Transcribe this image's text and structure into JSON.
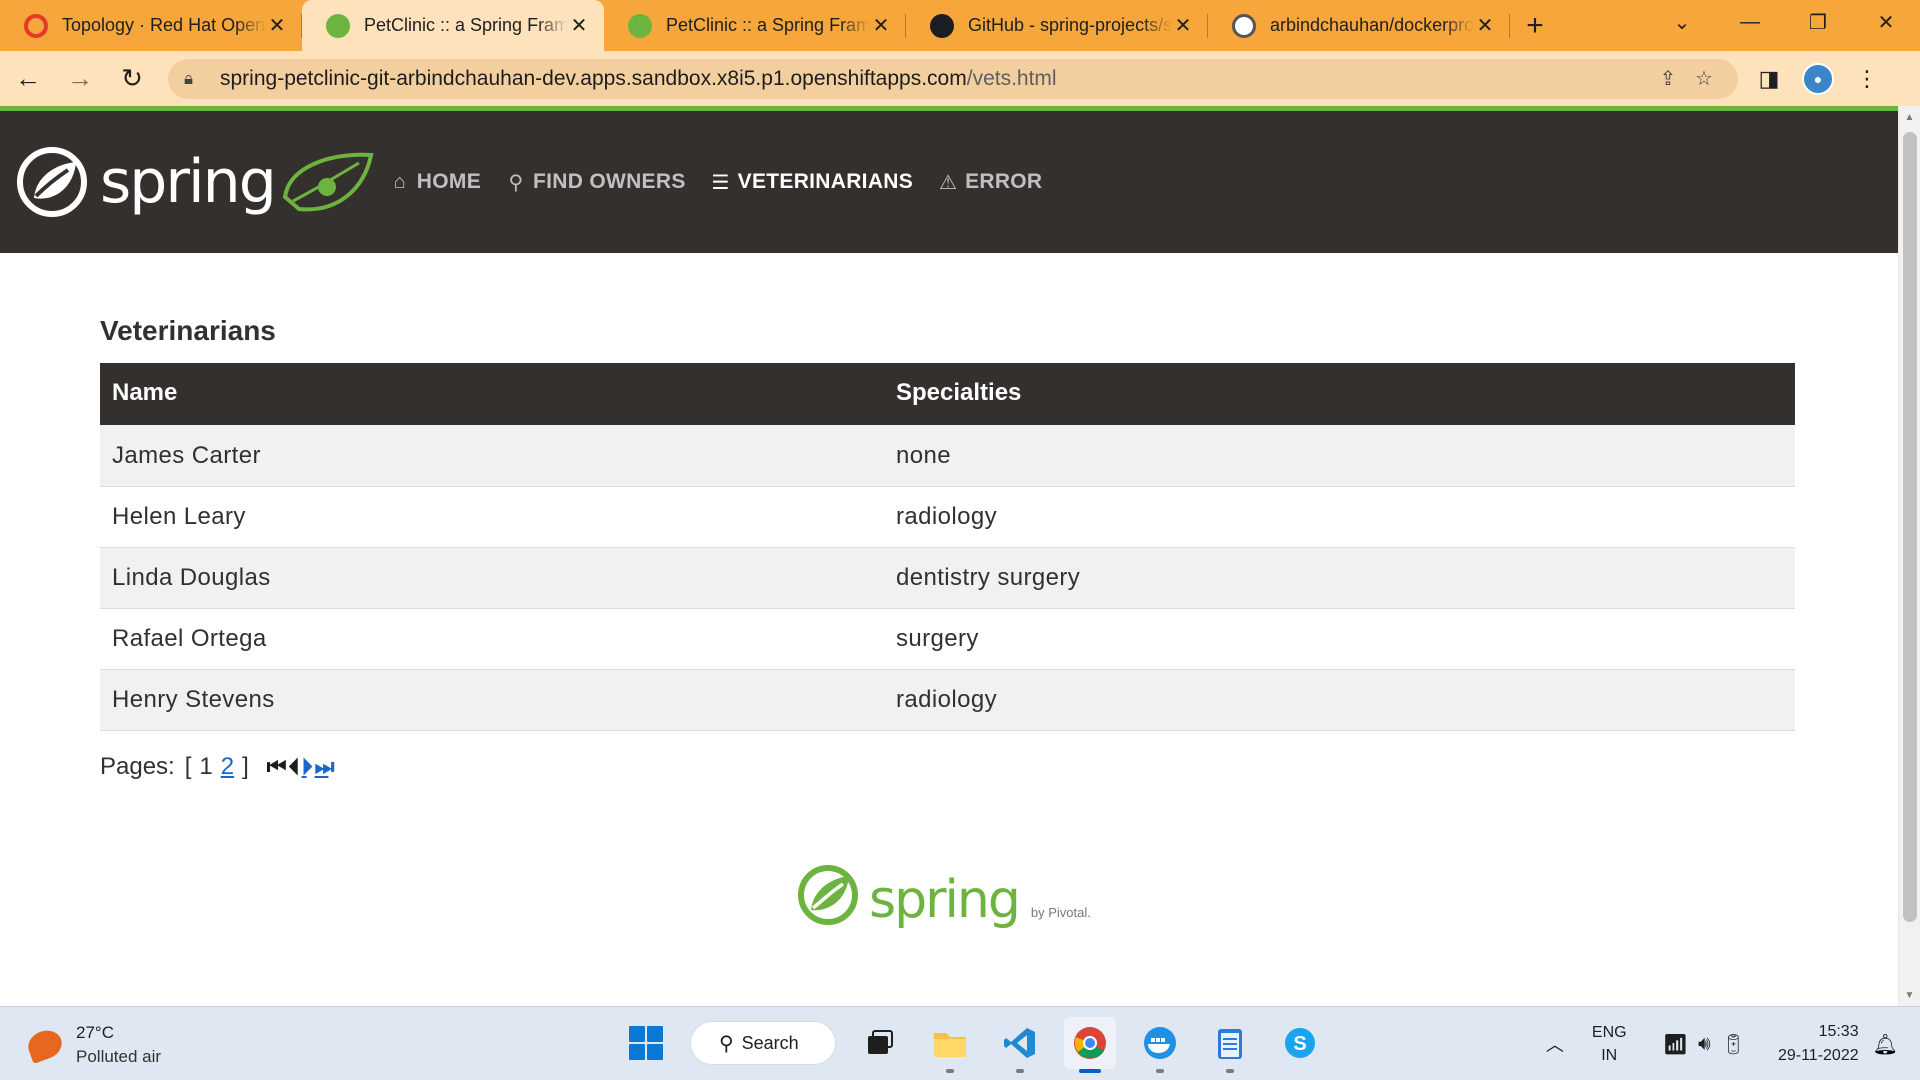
{
  "browser": {
    "tabs": [
      {
        "title": "Topology · Red Hat OpenShift",
        "favicon": "redhat-icon",
        "active": false
      },
      {
        "title": "PetClinic :: a Spring Framework demonstration",
        "favicon": "spring-icon",
        "active": true
      },
      {
        "title": "PetClinic :: a Spring Framework demonstration",
        "favicon": "spring-icon",
        "active": false
      },
      {
        "title": "GitHub - spring-projects/spring-petclinic",
        "favicon": "github-icon",
        "active": false
      },
      {
        "title": "arbindchauhan/dockerproject",
        "favicon": "docker-icon",
        "active": false
      }
    ],
    "url_host": "spring-petclinic-git-arbindchauhan-dev.apps.sandbox.x8i5.p1.openshiftapps.com",
    "url_path": "/vets.html"
  },
  "navbar": {
    "brand": "spring",
    "items": [
      {
        "label": "HOME",
        "icon": "home-icon",
        "active": false
      },
      {
        "label": "FIND OWNERS",
        "icon": "search-icon",
        "active": false
      },
      {
        "label": "VETERINARIANS",
        "icon": "list-icon",
        "active": true
      },
      {
        "label": "ERROR",
        "icon": "warning-icon",
        "active": false
      }
    ]
  },
  "page": {
    "title": "Veterinarians",
    "table": {
      "headers": [
        "Name",
        "Specialties"
      ],
      "rows": [
        {
          "name": "James Carter",
          "specialties": "none"
        },
        {
          "name": "Helen Leary",
          "specialties": "radiology"
        },
        {
          "name": "Linda Douglas",
          "specialties": "dentistry surgery"
        },
        {
          "name": "Rafael Ortega",
          "specialties": "surgery"
        },
        {
          "name": "Henry Stevens",
          "specialties": "radiology"
        }
      ]
    },
    "pager": {
      "label": "Pages:",
      "open_bracket": "[",
      "close_bracket": "]",
      "current_page": "1",
      "other_page": "2",
      "first": "⏮",
      "previous": "⏴",
      "next": "⏵",
      "last": "⏭"
    },
    "footer": {
      "brand": "spring",
      "by": "by Pivotal."
    }
  },
  "taskbar": {
    "temperature": "27°C",
    "weather_desc": "Polluted air",
    "search_label": "Search",
    "lang_1": "ENG",
    "lang_2": "IN",
    "time": "15:33",
    "date": "29-11-2022"
  },
  "colors": {
    "spring_green": "#6db33f",
    "navbar_bg": "#34302d",
    "tab_strip": "#f6a63a",
    "link_blue": "#1a66c9"
  }
}
